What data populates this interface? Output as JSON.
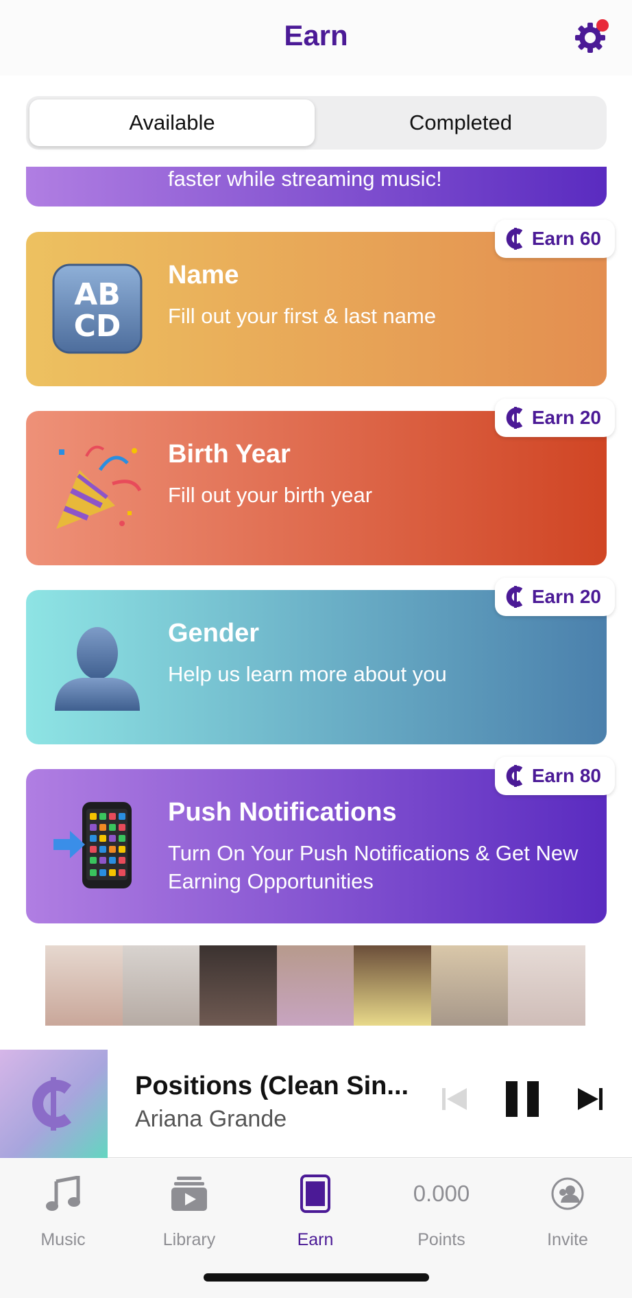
{
  "header": {
    "title": "Earn"
  },
  "segment": {
    "available": "Available",
    "completed": "Completed"
  },
  "top_card": {
    "text": "faster while streaming music!"
  },
  "cards": [
    {
      "title": "Name",
      "subtitle": "Fill out your first & last name",
      "badge": "Earn 60",
      "icon": "abcd-icon"
    },
    {
      "title": "Birth Year",
      "subtitle": "Fill out your birth year",
      "badge": "Earn 20",
      "icon": "party-popper-icon"
    },
    {
      "title": "Gender",
      "subtitle": "Help us learn more about you",
      "badge": "Earn 20",
      "icon": "person-silhouette-icon"
    },
    {
      "title": "Push Notifications",
      "subtitle": "Turn On Your Push Notifications & Get New Earning Opportunities",
      "badge": "Earn 80",
      "icon": "phone-arrow-icon"
    }
  ],
  "player": {
    "song": "Positions (Clean Sin...",
    "artist": "Ariana Grande"
  },
  "tabbar": {
    "music": "Music",
    "library": "Library",
    "earn": "Earn",
    "points_value": "0.000",
    "points": "Points",
    "invite": "Invite"
  },
  "colors": {
    "brand": "#4b1a96",
    "name_card": [
      "#edc160",
      "#e38e50"
    ],
    "birth_card": [
      "#ee9178",
      "#d04524"
    ],
    "gender_card": [
      "#8ee4e4",
      "#4b80ac"
    ],
    "push_card": [
      "#b07ee2",
      "#5a2bc0"
    ]
  }
}
